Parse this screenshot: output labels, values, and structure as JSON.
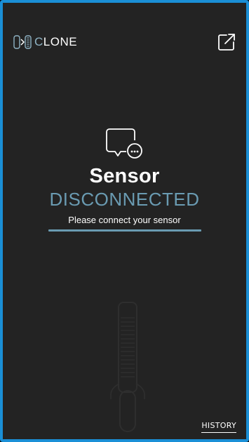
{
  "header": {
    "logo_prefix": "C",
    "logo_rest": "LONE",
    "logo_icon": "sensor-clip-logo-icon",
    "export_icon": "external-link-icon"
  },
  "status": {
    "icon": "chat-bubble-ellipsis-icon",
    "title": "Sensor",
    "state": "DISCONNECTED",
    "hint": "Please connect your sensor"
  },
  "footer": {
    "history_label": "HISTORY"
  },
  "colors": {
    "frame_border": "#1a8fd6",
    "background": "#232323",
    "accent": "#6a9bb2",
    "text": "#ffffff"
  }
}
